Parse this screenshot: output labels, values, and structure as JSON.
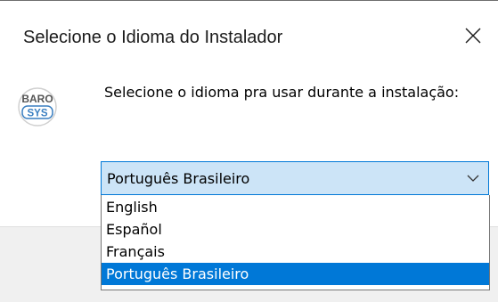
{
  "window": {
    "title": "Selecione o Idioma do Instalador",
    "close_icon": "close-icon"
  },
  "logo": {
    "top_text": "BARO",
    "bottom_text": "SYS",
    "colors": {
      "accent": "#3a7fc1",
      "text": "#4a4a4a",
      "ring": "#c8c8c8"
    }
  },
  "prompt": {
    "text": "Selecione o idioma pra usar durante a instalação:"
  },
  "language_select": {
    "selected_value": "Português Brasileiro",
    "chevron_icon": "chevron-down-icon",
    "options": [
      {
        "label": "English",
        "selected": false
      },
      {
        "label": "Español",
        "selected": false
      },
      {
        "label": "Français",
        "selected": false
      },
      {
        "label": "Português Brasileiro",
        "selected": true
      }
    ]
  },
  "colors": {
    "select_bg": "#cce4f7",
    "select_border": "#0078d7",
    "highlight": "#0078d7",
    "footer_bg": "#f0f0f0"
  }
}
